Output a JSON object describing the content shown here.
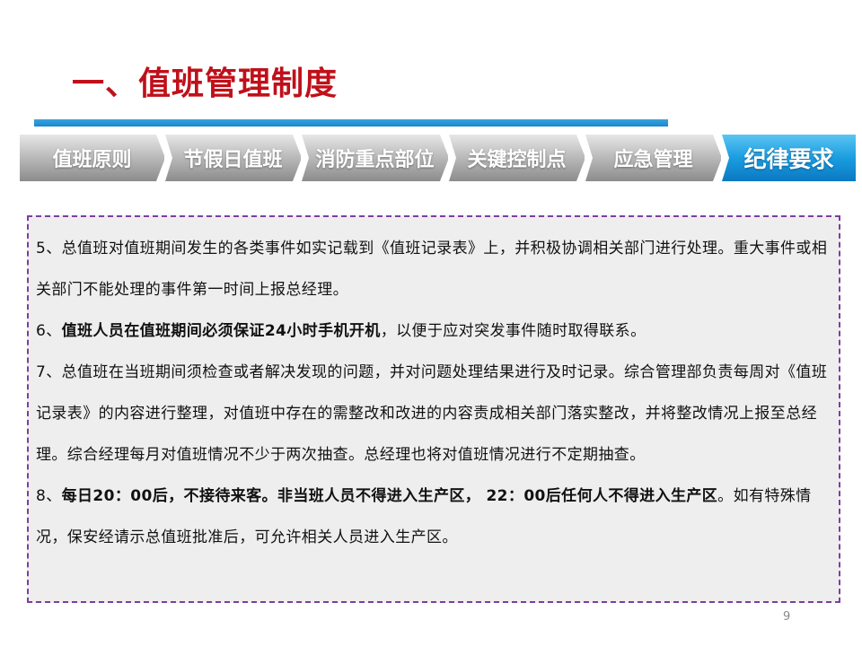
{
  "title": "一、值班管理制度",
  "tabs": [
    {
      "label": "值班原则",
      "active": false
    },
    {
      "label": "节假日值班",
      "active": false
    },
    {
      "label": "消防重点部位",
      "active": false
    },
    {
      "label": "关键控制点",
      "active": false
    },
    {
      "label": "应急管理",
      "active": false
    },
    {
      "label": "纪律要求",
      "active": true
    }
  ],
  "paragraphs": {
    "p5": "5、总值班对值班期间发生的各类事件如实记载到《值班记录表》上，并积极协调相关部门进行处理。重大事件或相关部门不能处理的事件第一时间上报总经理。",
    "p6_prefix": "6、",
    "p6_bold": "值班人员在值班期间必须保证24小时手机开机",
    "p6_rest": "，以便于应对突发事件随时取得联系。",
    "p7": "7、总值班在当班期间须检查或者解决发现的问题，并对问题处理结果进行及时记录。综合管理部负责每周对《值班记录表》的内容进行整理，对值班中存在的需整改和改进的内容责成相关部门落实整改，并将整改情况上报至总经理。综合经理每月对值班情况不少于两次抽查。总经理也将对值班情况进行不定期抽查。",
    "p8_prefix": "8、",
    "p8_bold": "每日20：00后，不接待来客。非当班人员不得进入生产区， 22：00后任何人不得进入生产区",
    "p8_rest": "。如有特殊情况，保安经请示总值班批准后，可允许相关人员进入生产区。"
  },
  "page_number": "9",
  "colors": {
    "title": "#c0101a",
    "underline": "#1a86cc",
    "active_tab": "#1a9de0",
    "inactive_tab": "#a8a8a8",
    "box_border": "#7a3fa0",
    "box_background": "#eeeeee"
  }
}
